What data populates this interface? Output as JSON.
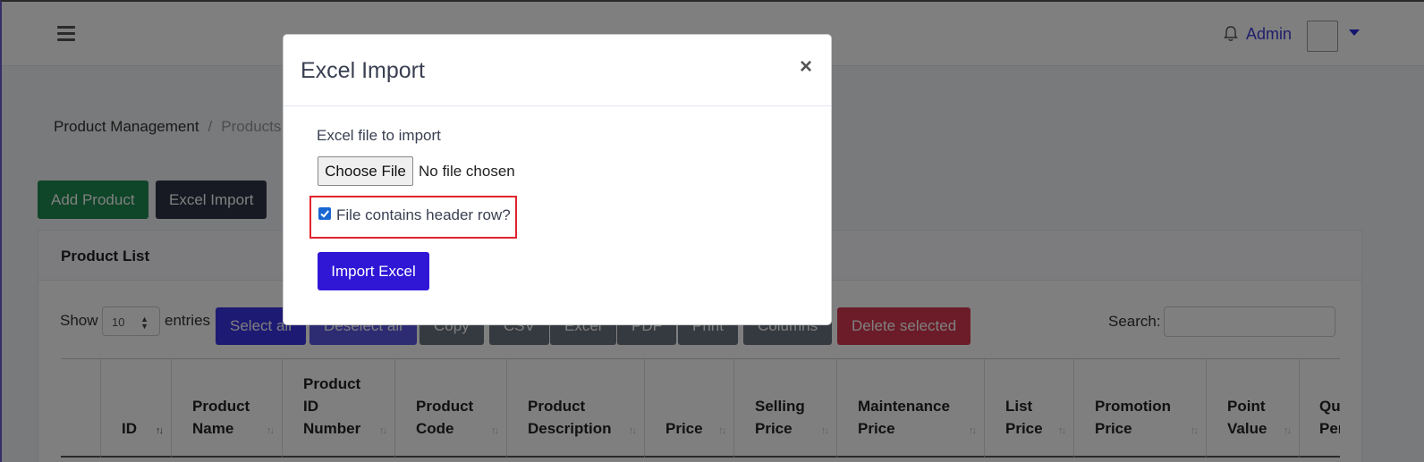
{
  "topbar": {
    "user_name": "Admin"
  },
  "breadcrumb": {
    "items": [
      "Product Management",
      "Products"
    ],
    "separator": "/"
  },
  "actions": {
    "add_label": "Add Product",
    "excel_label": "Excel Import"
  },
  "card": {
    "title": "Product List"
  },
  "table_controls": {
    "show_label": "Show",
    "page_length": "10",
    "entries_label": "entries",
    "buttons": [
      "Select all",
      "Deselect all",
      "Copy",
      "CSV",
      "Excel",
      "PDF",
      "Print",
      "Columns",
      "Delete selected"
    ],
    "search_label": "Search:"
  },
  "table": {
    "columns": [
      "",
      "ID",
      "Product\nName",
      "Product\nID\nNumber",
      "Product\nCode",
      "Product\nDescription",
      "Price",
      "Selling\nPrice",
      "Maintenance\nPrice",
      "List\nPrice",
      "Promotion\nPrice",
      "Point\nValue",
      "Qu\nPer"
    ]
  },
  "modal": {
    "title": "Excel Import",
    "close_symbol": "×",
    "file_label": "Excel file to import",
    "choose_file_label": "Choose File",
    "no_file_text": "No file chosen",
    "header_row_label": "File contains header row?",
    "header_row_checked": true,
    "import_label": "Import Excel"
  },
  "colors": {
    "primary": "#3017d6",
    "success": "#1e8a50",
    "dark": "#2e3545",
    "danger": "#d63850",
    "highlight": "#e0232e"
  }
}
